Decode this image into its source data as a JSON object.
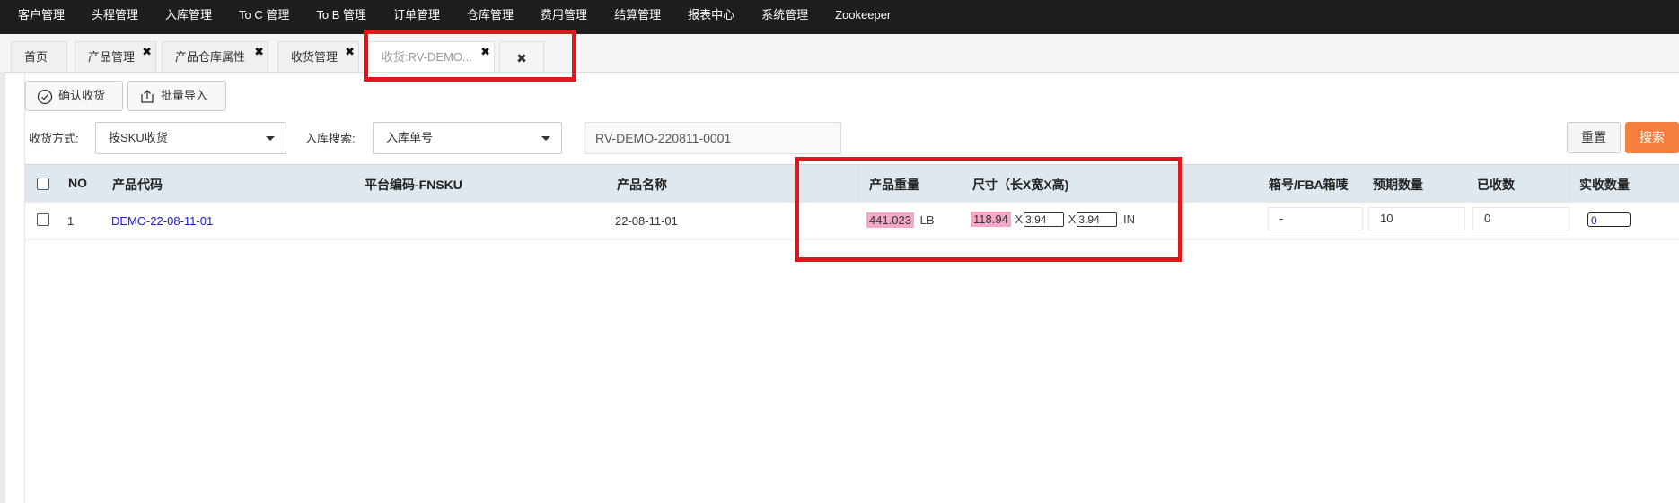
{
  "topnav": [
    "客户管理",
    "头程管理",
    "入库管理",
    "To C 管理",
    "To B 管理",
    "订单管理",
    "仓库管理",
    "费用管理",
    "结算管理",
    "报表中心",
    "系统管理",
    "Zookeeper"
  ],
  "tabs": {
    "home": "首页",
    "product_mgmt": "产品管理",
    "product_wh_attr": "产品仓库属性",
    "receiving_mgmt": "收货管理",
    "receiving_doc": "收货:RV-DEMO...",
    "close_glyph": "✖"
  },
  "toolbar": {
    "confirm": "确认收货",
    "import": "批量导入"
  },
  "filters": {
    "mode_label": "收货方式:",
    "mode_value": "按SKU收货",
    "search_label": "入库搜索:",
    "search_type": "入库单号",
    "search_value": "RV-DEMO-220811-0001",
    "reset": "重置",
    "search": "搜索"
  },
  "table": {
    "headers": {
      "no": "NO",
      "code": "产品代码",
      "fnsku": "平台编码-FNSKU",
      "name": "产品名称",
      "weight": "产品重量",
      "size": "尺寸（长X宽X高)",
      "box": "箱号/FBA箱唛",
      "expected": "预期数量",
      "received": "已收数",
      "actual": "实收数量"
    },
    "rows": [
      {
        "no": "1",
        "code": "DEMO-22-08-11-01",
        "fnsku": "",
        "name": "22-08-11-01",
        "weight": "441.023",
        "weight_unit": "LB",
        "len": "118.94",
        "wid": "3.94",
        "hei": "3.94",
        "x": "X",
        "size_unit": "IN",
        "box": "-",
        "expected": "10",
        "received": "0",
        "actual": "0"
      }
    ]
  }
}
